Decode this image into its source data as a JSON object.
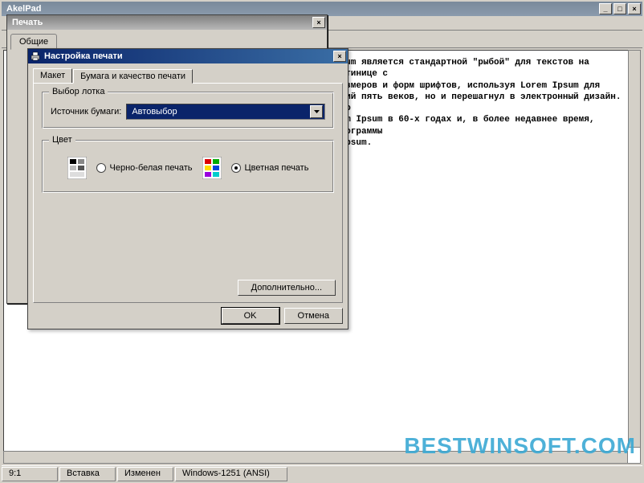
{
  "app": {
    "title": "AkelPad",
    "min": "_",
    "max": "□",
    "close": "×"
  },
  "editor": {
    "text": "psum является стандартной \"рыбой\" для текстов на латинице с\nразмеров и форм шрифтов, используя Lorem Ipsum для\nений пять веков, но и перешагнул в электронный дизайн. Его\nrem Ipsum в 60-х годах и, в более недавнее время, программы\n Ipsum."
  },
  "status": {
    "pos": "9:1",
    "mode": "Вставка",
    "modified": "Изменен",
    "encoding": "Windows-1251 (ANSI)"
  },
  "print_dialog": {
    "title": "Печать",
    "tab_general": "Общие"
  },
  "setup_dialog": {
    "title": "Настройка печати",
    "close": "×",
    "tab_layout": "Макет",
    "tab_paper": "Бумага и качество печати",
    "tray_group": "Выбор лотка",
    "source_label": "Источник бумаги:",
    "source_value": "Автовыбор",
    "color_group": "Цвет",
    "bw_label": "Черно-белая печать",
    "color_label": "Цветная печать",
    "advanced": "Дополнительно...",
    "ok": "OK",
    "cancel": "Отмена"
  },
  "watermark": "BESTWINSOFT.COM"
}
